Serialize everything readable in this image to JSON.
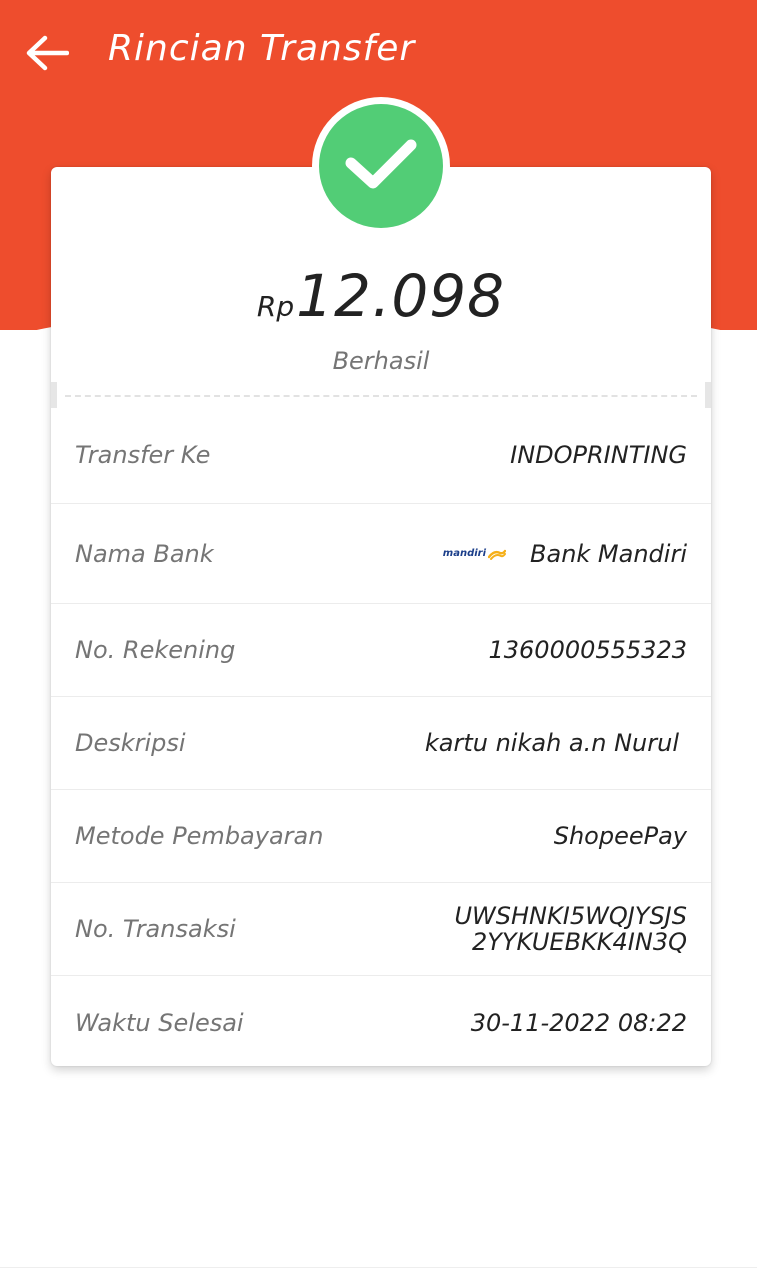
{
  "colors": {
    "accent": "#ee4d2d",
    "success": "#52cd76",
    "bank_logo_blue": "#1b3e8a",
    "bank_logo_gold": "#f5b01a"
  },
  "header": {
    "title": "Rincian Transfer",
    "back_icon": "arrow-left-icon"
  },
  "summary": {
    "status_icon": "check-icon",
    "currency": "Rp",
    "amount": "12.098",
    "status": "Berhasil"
  },
  "details": {
    "transfer_to": {
      "label": "Transfer Ke",
      "value": "INDOPRINTING"
    },
    "bank_name": {
      "label": "Nama Bank",
      "value": "Bank Mandiri",
      "logo_text": "mandiri"
    },
    "account_number": {
      "label": "No. Rekening",
      "value": "1360000555323"
    },
    "description": {
      "label": "Deskripsi",
      "value": "kartu nikah a.n Nurul"
    },
    "payment_method": {
      "label": "Metode Pembayaran",
      "value": "ShopeePay"
    },
    "transaction_number": {
      "label": "No. Transaksi",
      "value_line1": "UWSHNKI5WQJYSJS",
      "value_line2": "2YYKUEBKK4IN3Q"
    },
    "completed_time": {
      "label": "Waktu Selesai",
      "value": "30-11-2022 08:22"
    }
  }
}
